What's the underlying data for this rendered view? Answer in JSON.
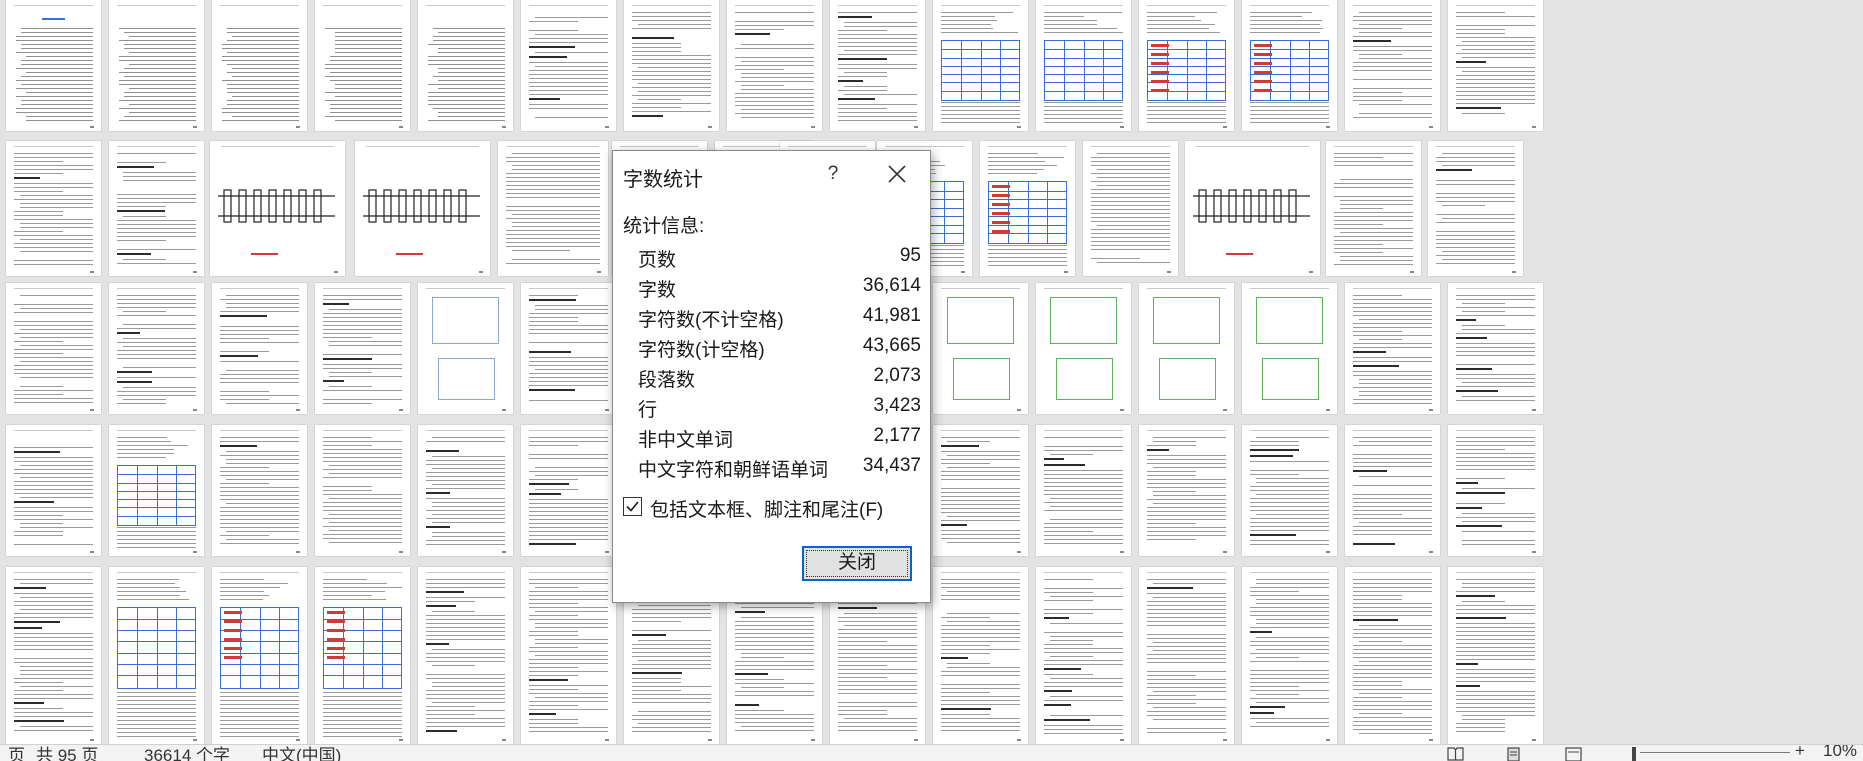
{
  "dialog": {
    "title": "字数统计",
    "help": "?",
    "stats_heading": "统计信息:",
    "stats": [
      {
        "label": "页数",
        "value": "95"
      },
      {
        "label": "字数",
        "value": "36,614"
      },
      {
        "label": "字符数(不计空格)",
        "value": "41,981"
      },
      {
        "label": "字符数(计空格)",
        "value": "43,665"
      },
      {
        "label": "段落数",
        "value": "2,073"
      },
      {
        "label": "行",
        "value": "3,423"
      },
      {
        "label": "非中文单词",
        "value": "2,177"
      },
      {
        "label": "中文字符和朝鲜语单词",
        "value": "34,437"
      }
    ],
    "include_checkbox": {
      "label": "包括文本框、脚注和尾注(F)",
      "checked": true
    },
    "close_button": "关闭"
  },
  "statusbar": {
    "page": "页",
    "page_count": "共 95 页",
    "word_count": "36614 个字",
    "language": "中文(中国)",
    "zoom": "10%"
  },
  "icons": {
    "close": "close-icon",
    "check": "checkmark-icon",
    "read_mode": "read-mode-icon",
    "print_layout": "print-layout-icon",
    "web_layout": "web-layout-icon",
    "zoom_in": "plus-icon"
  },
  "colors": {
    "background": "#e3e3e3",
    "accent": "#0a64c8",
    "table_blue": "#3a6fd8",
    "table_red": "#d23a3a",
    "drawing_green": "#5db35d"
  }
}
